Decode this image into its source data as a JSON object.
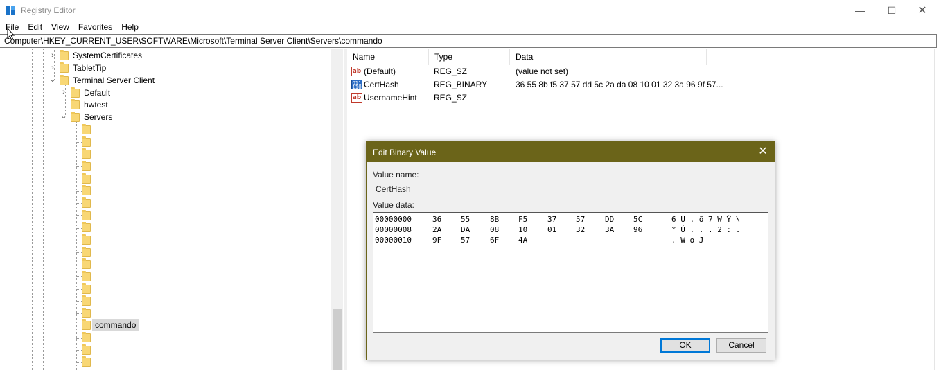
{
  "window": {
    "title": "Registry Editor",
    "minimize_glyph": "—",
    "maximize_glyph": "☐",
    "close_glyph": "✕"
  },
  "menu": [
    "File",
    "Edit",
    "View",
    "Favorites",
    "Help"
  ],
  "address": "Computer\\HKEY_CURRENT_USER\\SOFTWARE\\Microsoft\\Terminal Server Client\\Servers\\commando",
  "tree": {
    "system_certificates": "SystemCertificates",
    "tablet_tip": "TabletTip",
    "terminal_server_client": "Terminal Server Client",
    "default": "Default",
    "hwtest": "hwtest",
    "servers": "Servers",
    "commando": "commando",
    "collapsed_glyph": "›",
    "expanded_glyph": "⌄"
  },
  "list": {
    "headers": [
      "Name",
      "Type",
      "Data"
    ],
    "rows": [
      {
        "icon": "string-value-icon",
        "name": "(Default)",
        "type": "REG_SZ",
        "data": "(value not set)"
      },
      {
        "icon": "binary-value-icon",
        "name": "CertHash",
        "type": "REG_BINARY",
        "data": "36 55 8b f5 37 57 dd 5c 2a da 08 10 01 32 3a 96 9f 57..."
      },
      {
        "icon": "string-value-icon",
        "name": "UsernameHint",
        "type": "REG_SZ",
        "data": ""
      }
    ]
  },
  "dialog": {
    "title": "Edit Binary Value",
    "close_glyph": "✕",
    "value_name_label": "Value name:",
    "value_name": "CertHash",
    "value_data_label": "Value data:",
    "hex_rows": [
      {
        "offset": "00000000",
        "bytes": [
          "36",
          "55",
          "8B",
          "F5",
          "37",
          "57",
          "DD",
          "5C"
        ],
        "ascii": "6 U . õ 7 W Ý \\"
      },
      {
        "offset": "00000008",
        "bytes": [
          "2A",
          "DA",
          "08",
          "10",
          "01",
          "32",
          "3A",
          "96"
        ],
        "ascii": "* Ú . . . 2 : ."
      },
      {
        "offset": "00000010",
        "bytes": [
          "9F",
          "57",
          "6F",
          "4A"
        ],
        "ascii": ". W o J"
      }
    ],
    "ok_label": "OK",
    "cancel_label": "Cancel"
  },
  "colors": {
    "dialog_title_bar": "#6b6419",
    "selection": "#d9d9d9",
    "folder": "#f8d775",
    "ok_focus_border": "#0078d7"
  }
}
